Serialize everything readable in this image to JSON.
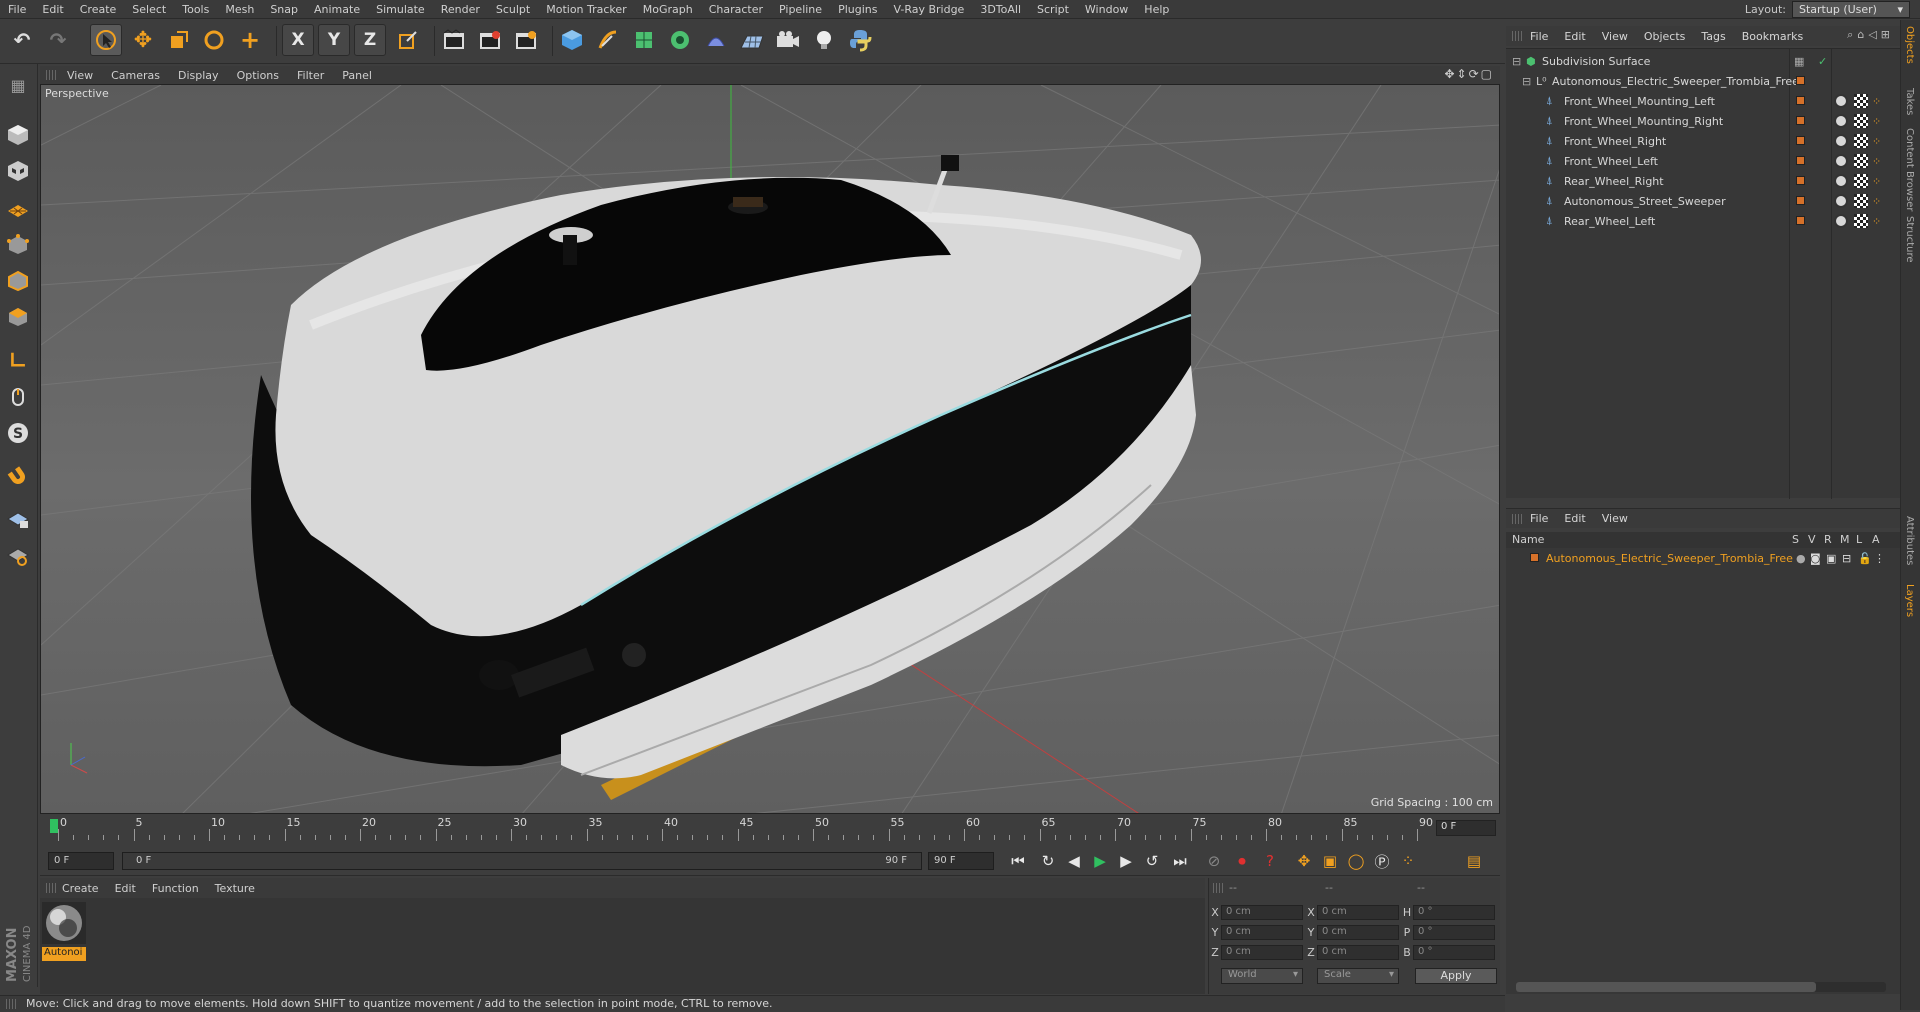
{
  "menubar": {
    "items": [
      "File",
      "Edit",
      "Create",
      "Select",
      "Tools",
      "Mesh",
      "Snap",
      "Animate",
      "Simulate",
      "Render",
      "Sculpt",
      "Motion Tracker",
      "MoGraph",
      "Character",
      "Pipeline",
      "Plugins",
      "V-Ray Bridge",
      "3DToAll",
      "Script",
      "Window",
      "Help"
    ],
    "layout_label": "Layout:",
    "layout_value": "Startup (User)"
  },
  "toolbar": {
    "x_label": "X",
    "y_label": "Y",
    "z_label": "Z"
  },
  "viewport": {
    "menu": [
      "View",
      "Cameras",
      "Display",
      "Options",
      "Filter",
      "Panel"
    ],
    "label": "Perspective",
    "grid_spacing": "Grid Spacing : 100 cm"
  },
  "timeline": {
    "ticks": [
      "0",
      "5",
      "10",
      "15",
      "20",
      "25",
      "30",
      "35",
      "40",
      "45",
      "50",
      "55",
      "60",
      "65",
      "70",
      "75",
      "80",
      "85",
      "90"
    ],
    "end_field": "0 F"
  },
  "transport": {
    "start_field": "0 F",
    "slider_start": "0 F",
    "slider_end": "90 F",
    "end_field": "90 F"
  },
  "material_manager": {
    "menu": [
      "Create",
      "Edit",
      "Function",
      "Texture"
    ],
    "material_name": "Autonoi"
  },
  "coordinates": {
    "header": [
      "--",
      "--",
      "--"
    ],
    "rows": [
      {
        "l1": "X",
        "v1": "0 cm",
        "l2": "X",
        "v2": "0 cm",
        "l3": "H",
        "v3": "0 °"
      },
      {
        "l1": "Y",
        "v1": "0 cm",
        "l2": "Y",
        "v2": "0 cm",
        "l3": "P",
        "v3": "0 °"
      },
      {
        "l1": "Z",
        "v1": "0 cm",
        "l2": "Z",
        "v2": "0 cm",
        "l3": "B",
        "v3": "0 °"
      }
    ],
    "world": "World",
    "scale": "Scale",
    "apply": "Apply"
  },
  "status": "Move: Click and drag to move elements. Hold down SHIFT to quantize movement / add to the selection in point mode, CTRL to remove.",
  "object_manager": {
    "menu": [
      "File",
      "Edit",
      "View",
      "Objects",
      "Tags",
      "Bookmarks"
    ],
    "root": "Subdivision Surface",
    "group": "Autonomous_Electric_Sweeper_Trombia_Free",
    "children": [
      "Front_Wheel_Mounting_Left",
      "Front_Wheel_Mounting_Right",
      "Front_Wheel_Right",
      "Front_Wheel_Left",
      "Rear_Wheel_Right",
      "Autonomous_Street_Sweeper",
      "Rear_Wheel_Left"
    ]
  },
  "layer_manager": {
    "menu": [
      "File",
      "Edit",
      "View"
    ],
    "columns": [
      "Name",
      "S",
      "V",
      "R",
      "M",
      "L",
      "A"
    ],
    "layer": "Autonomous_Electric_Sweeper_Trombia_Free"
  },
  "side_tabs": [
    "Objects",
    "Takes",
    "Content Browser",
    "Structure",
    "Attributes",
    "Layers"
  ],
  "brand": "MAXON CINEMA 4D",
  "colors": {
    "accent": "#f0a020",
    "selected_text": "#f0a020",
    "object_dot": "#d6712a"
  }
}
